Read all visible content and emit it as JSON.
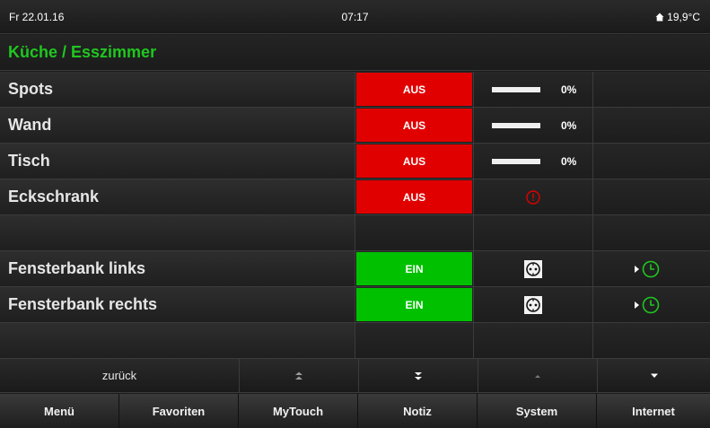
{
  "status": {
    "date": "Fr 22.01.16",
    "time": "07:17",
    "temperature": "19,9°C"
  },
  "room": {
    "title": "Küche / Esszimmer"
  },
  "devices": [
    {
      "name": "Spots",
      "state": "AUS",
      "level": "0%"
    },
    {
      "name": "Wand",
      "state": "AUS",
      "level": "0%"
    },
    {
      "name": "Tisch",
      "state": "AUS",
      "level": "0%"
    },
    {
      "name": "Eckschrank",
      "state": "AUS",
      "extra_icon": "alert-circle-icon"
    },
    {
      "name": ""
    },
    {
      "name": "Fensterbank links",
      "state": "EIN",
      "extra_icon": "socket-icon",
      "timer_icon": "clock-icon"
    },
    {
      "name": "Fensterbank rechts",
      "state": "EIN",
      "extra_icon": "socket-icon",
      "timer_icon": "clock-icon"
    },
    {
      "name": ""
    }
  ],
  "nav": {
    "back": "zurück"
  },
  "menu": {
    "items": [
      "Menü",
      "Favoriten",
      "MyTouch",
      "Notiz",
      "System",
      "Internet"
    ]
  },
  "colors": {
    "on": "#00c000",
    "off": "#e00000",
    "accent_green": "#1fc71f"
  }
}
